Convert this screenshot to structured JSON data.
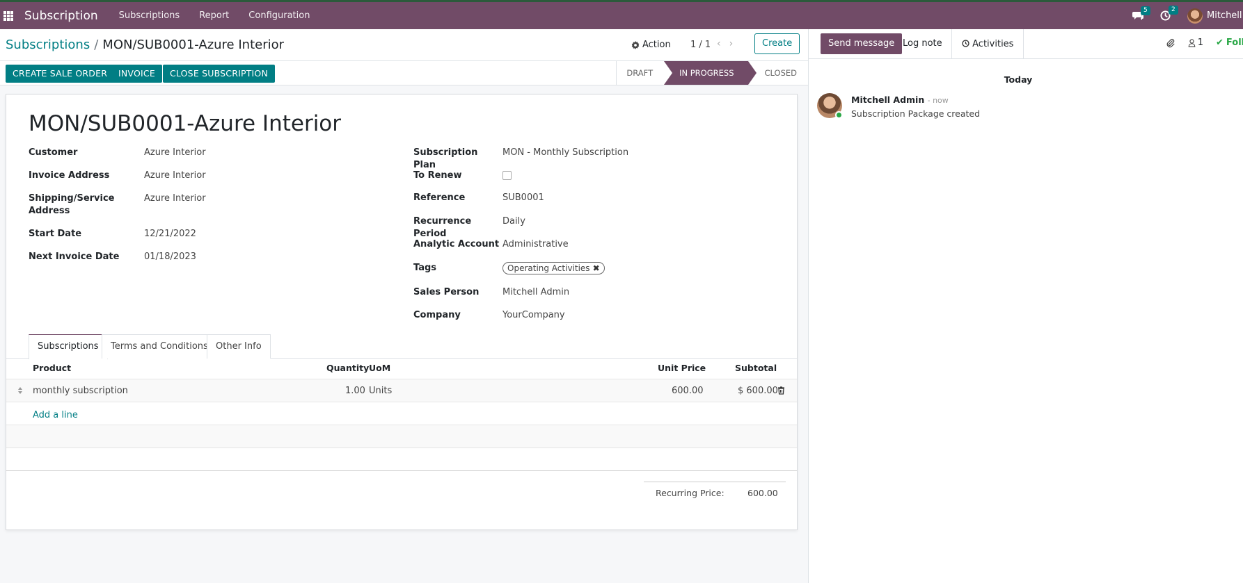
{
  "navbar": {
    "app_name": "Subscription",
    "menu": [
      "Subscriptions",
      "Report",
      "Configuration"
    ],
    "messages_count": "5",
    "activities_count": "2",
    "user": "Mitchell Admin",
    "icons": [
      "apps-grid-icon",
      "chat-icon",
      "clock-icon",
      "avatar"
    ]
  },
  "control_panel": {
    "breadcrumb_parent": "Subscriptions",
    "breadcrumb_sep": "/",
    "breadcrumb_current": "MON/SUB0001-Azure Interior",
    "action_label": "Action",
    "pager": "1 / 1",
    "create_label": "Create"
  },
  "statusbar": {
    "buttons": [
      "CREATE SALE ORDER",
      "INVOICE",
      "CLOSE SUBSCRIPTION"
    ],
    "stages": [
      "DRAFT",
      "IN PROGRESS",
      "CLOSED"
    ],
    "active_stage": "IN PROGRESS"
  },
  "record": {
    "title": "MON/SUB0001-Azure Interior",
    "left_fields": [
      {
        "label": "Customer",
        "value": "Azure Interior"
      },
      {
        "label": "Invoice Address",
        "value": "Azure Interior"
      },
      {
        "label": "Shipping/Service Address",
        "value": "Azure Interior"
      },
      {
        "label": "Start Date",
        "value": "12/21/2022"
      },
      {
        "label": "Next Invoice Date",
        "value": "01/18/2023"
      }
    ],
    "right_fields": [
      {
        "label": "Subscription Plan",
        "value": "MON - Monthly Subscription"
      },
      {
        "label": "To Renew",
        "value": ""
      },
      {
        "label": "Reference",
        "value": "SUB0001"
      },
      {
        "label": "Recurrence Period",
        "value": "Daily"
      },
      {
        "label": "Analytic Account",
        "value": "Administrative"
      },
      {
        "label": "Tags",
        "value": "Operating Activities"
      },
      {
        "label": "Sales Person",
        "value": "Mitchell Admin"
      },
      {
        "label": "Company",
        "value": "YourCompany"
      }
    ]
  },
  "tabs": [
    "Subscriptions",
    "Terms and Conditions",
    "Other Info"
  ],
  "lines": {
    "headers": {
      "product": "Product",
      "quantity": "Quantity",
      "uom": "UoM",
      "unit_price": "Unit Price",
      "subtotal": "Subtotal"
    },
    "rows": [
      {
        "product": "monthly subscription",
        "quantity": "1.00",
        "uom": "Units",
        "unit_price": "600.00",
        "subtotal": "$ 600.00"
      }
    ],
    "add_line": "Add a line"
  },
  "totals": {
    "label": "Recurring Price:",
    "value": "600.00"
  },
  "chatter": {
    "send_message": "Send message",
    "log_note": "Log note",
    "activities": "Activities",
    "followers_count": "1",
    "follow_label": "Following",
    "date_separator": "Today",
    "messages": [
      {
        "author": "Mitchell Admin",
        "time": "- now",
        "body": "Subscription Package created"
      }
    ]
  },
  "colors": {
    "brand": "#714b67",
    "accent": "#017e84"
  }
}
